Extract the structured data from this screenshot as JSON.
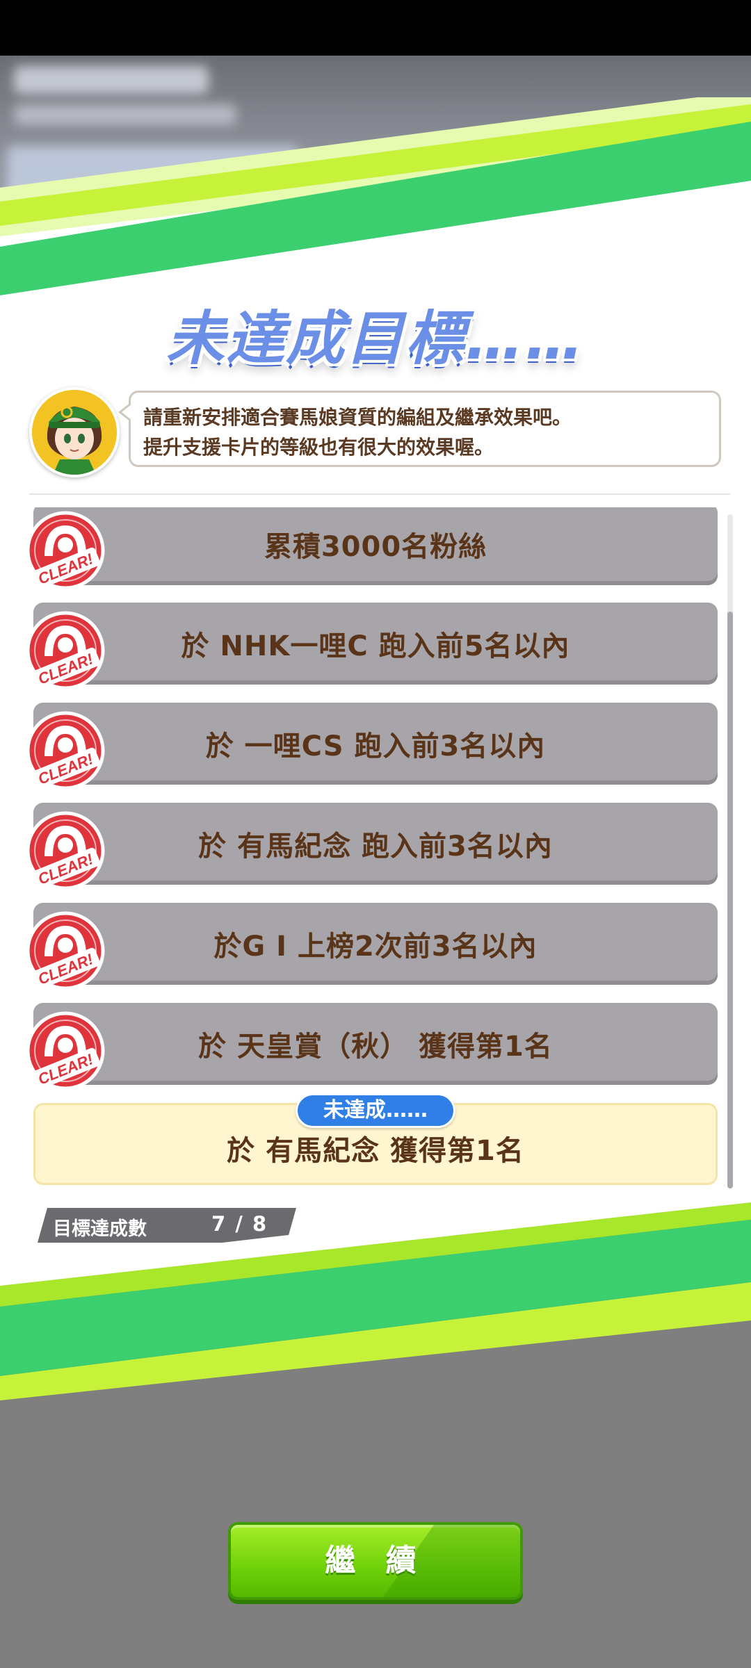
{
  "dialog": {
    "title": "未達成目標……",
    "hint_lines": [
      "請重新安排適合賽馬娘資質的編組及繼承效果吧。",
      "提升支援卡片的等級也有很大的效果喔。"
    ]
  },
  "goals": [
    {
      "label": "累積3000名粉絲",
      "status": "clear",
      "badge_text": "CLEAR!"
    },
    {
      "label": "於 NHK一哩C 跑入前5名以內",
      "status": "clear",
      "badge_text": "CLEAR!"
    },
    {
      "label": "於 一哩CS 跑入前3名以內",
      "status": "clear",
      "badge_text": "CLEAR!"
    },
    {
      "label": "於 有馬紀念 跑入前3名以內",
      "status": "clear",
      "badge_text": "CLEAR!"
    },
    {
      "label": "於G I 上榜2次前3名以內",
      "status": "clear",
      "badge_text": "CLEAR!"
    },
    {
      "label": "於 天皇賞（秋） 獲得第1名",
      "status": "clear",
      "badge_text": "CLEAR!"
    },
    {
      "label": "於 有馬紀念 獲得第1名",
      "status": "pending",
      "tag": "未達成……"
    }
  ],
  "counter": {
    "label": "目標達成數",
    "value": "7 / 8"
  },
  "continue_button": {
    "label": "繼 續"
  },
  "colors": {
    "accent_green": "#6fd10a",
    "stripe_green": "#3ccf70",
    "stripe_lime": "#c7f23a",
    "pending_blue": "#2f7fe6",
    "clear_red": "#e0343c",
    "text_brown": "#5a3418"
  },
  "icons": {
    "avatar": "trainer-girl-avatar",
    "badge": "clear-horseshoe-badge"
  }
}
